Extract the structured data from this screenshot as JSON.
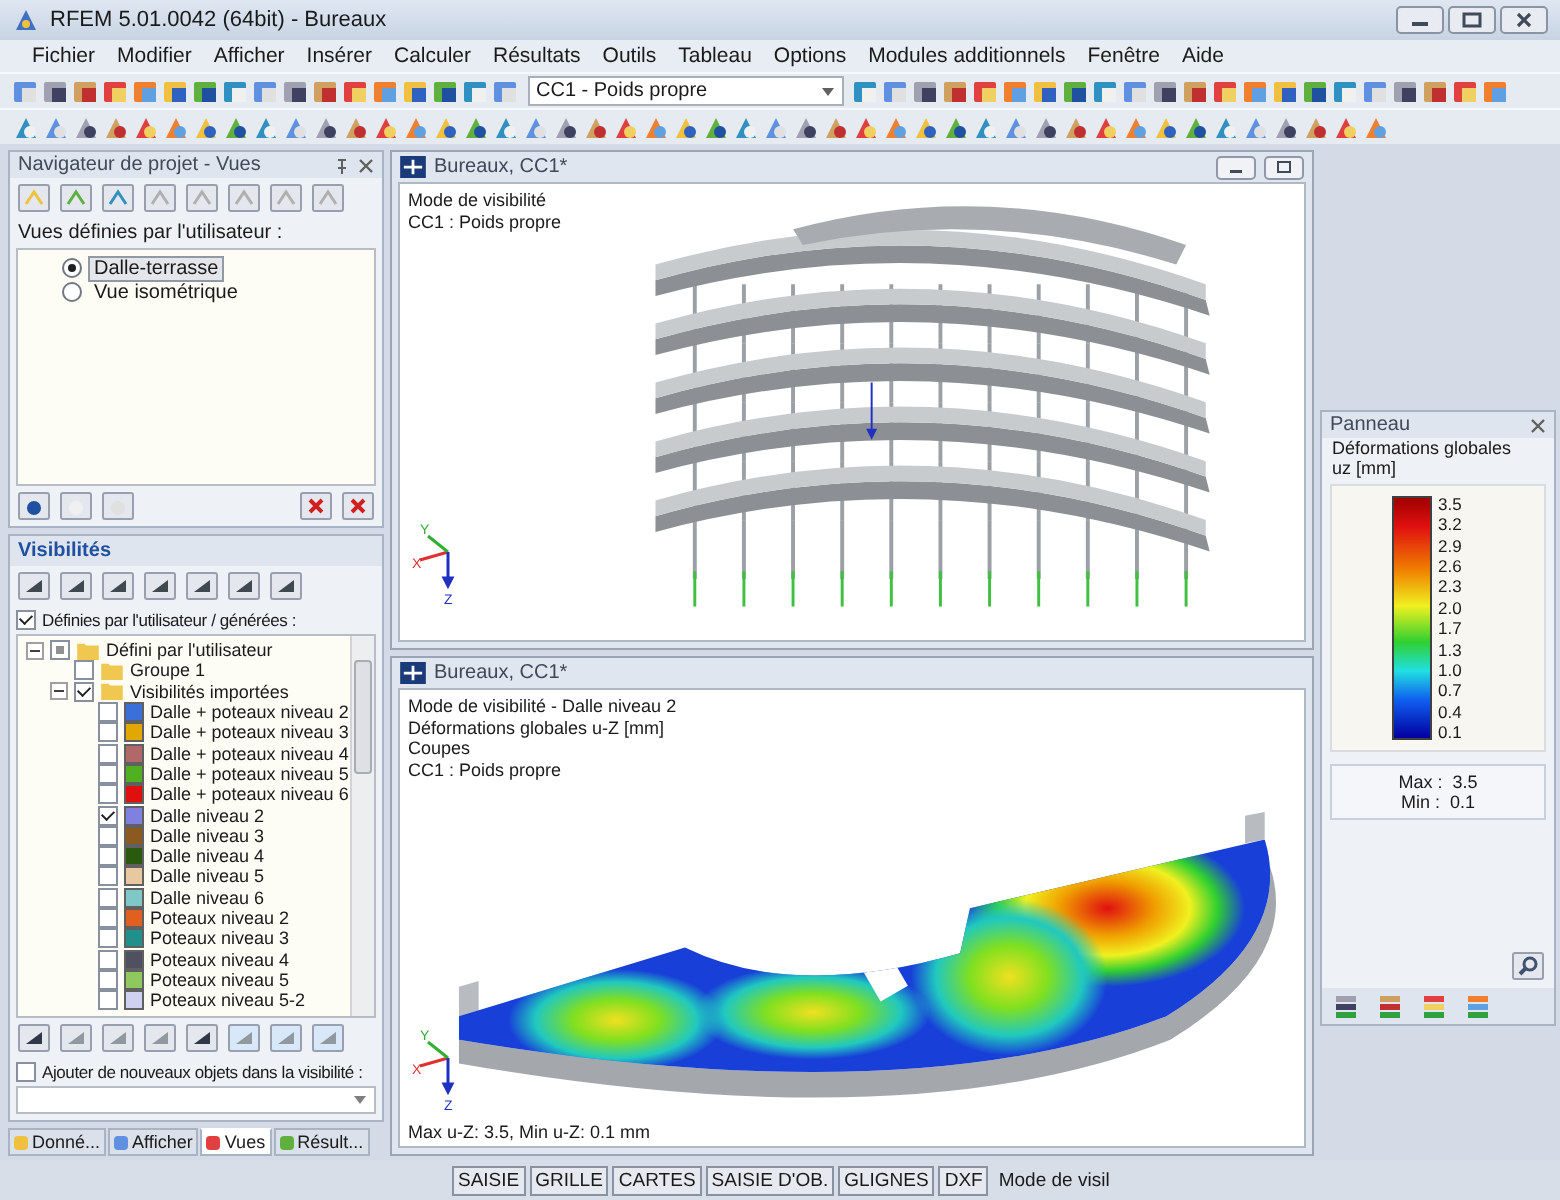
{
  "window": {
    "title": "RFEM 5.01.0042 (64bit) - Bureaux"
  },
  "menu": [
    "Fichier",
    "Modifier",
    "Afficher",
    "Insérer",
    "Calculer",
    "Résultats",
    "Outils",
    "Tableau",
    "Options",
    "Modules additionnels",
    "Fenêtre",
    "Aide"
  ],
  "toolbar": {
    "load_case": "CC1 - Poids propre"
  },
  "navigator": {
    "title": "Navigateur de projet - Vues",
    "views_label": "Vues définies par l'utilisateur :",
    "views": [
      {
        "label": "Dalle-terrasse",
        "selected": true
      },
      {
        "label": "Vue isométrique",
        "selected": false
      }
    ]
  },
  "visibilities": {
    "title": "Visibilités",
    "filter": {
      "label": "Définies par l'utilisateur / générées :",
      "checked": true
    },
    "tree": [
      {
        "label": "Défini par l'utilisateur",
        "indeterminate": true,
        "expanded": true,
        "children": [
          {
            "label": "Groupe 1",
            "checked": false
          },
          {
            "label": "Visibilités importées",
            "checked": true,
            "expanded": true,
            "children": [
              {
                "label": "Dalle + poteaux niveau 2",
                "checked": false,
                "color": "#3a70d8"
              },
              {
                "label": "Dalle + poteaux niveau 3",
                "checked": false,
                "color": "#e0a800"
              },
              {
                "label": "Dalle + poteaux niveau 4",
                "checked": false,
                "color": "#b06868"
              },
              {
                "label": "Dalle + poteaux niveau 5",
                "checked": false,
                "color": "#50b020"
              },
              {
                "label": "Dalle + poteaux niveau 6",
                "checked": false,
                "color": "#e01010"
              },
              {
                "label": "Dalle niveau 2",
                "checked": true,
                "color": "#8080e0"
              },
              {
                "label": "Dalle niveau 3",
                "checked": false,
                "color": "#8a5a20"
              },
              {
                "label": "Dalle niveau 4",
                "checked": false,
                "color": "#2a5a10"
              },
              {
                "label": "Dalle niveau 5",
                "checked": false,
                "color": "#e8c8a0"
              },
              {
                "label": "Dalle niveau 6",
                "checked": false,
                "color": "#80c8c8"
              },
              {
                "label": "Poteaux niveau 2",
                "checked": false,
                "color": "#e06020"
              },
              {
                "label": "Poteaux niveau 3",
                "checked": false,
                "color": "#20908a"
              },
              {
                "label": "Poteaux niveau 4",
                "checked": false,
                "color": "#505060"
              },
              {
                "label": "Poteaux niveau 5",
                "checked": false,
                "color": "#90c860"
              },
              {
                "label": "Poteaux niveau 5-2",
                "checked": false,
                "color": "#d0d0f0"
              }
            ]
          }
        ]
      }
    ],
    "add_objects": {
      "label": "Ajouter de nouveaux objets dans la visibilité :",
      "checked": false
    },
    "tabs": [
      {
        "label": "Donné...",
        "selected": false
      },
      {
        "label": "Afficher",
        "selected": false
      },
      {
        "label": "Vues",
        "selected": true
      },
      {
        "label": "Résult...",
        "selected": false
      }
    ]
  },
  "views": [
    {
      "title": "Bureaux, CC1*",
      "kind": "building",
      "info": [
        "Mode de visibilité",
        "CC1 : Poids propre"
      ],
      "axes": [
        "X",
        "Y",
        "Z"
      ]
    },
    {
      "title": "Bureaux, CC1*",
      "kind": "contour",
      "info": [
        "Mode de visibilité - Dalle niveau 2",
        "Déformations globales u-Z [mm]",
        "Coupes",
        "CC1 : Poids propre"
      ],
      "axes": [
        "X",
        "Y",
        "Z"
      ],
      "footer": "Max u-Z: 3.5, Min u-Z: 0.1 mm"
    }
  ],
  "panel": {
    "title": "Panneau",
    "heading": "Déformations globales",
    "unit": "uz [mm]",
    "legend": [
      "3.5",
      "3.2",
      "2.9",
      "2.6",
      "2.3",
      "2.0",
      "1.7",
      "1.3",
      "1.0",
      "0.7",
      "0.4",
      "0.1"
    ],
    "max_label": "Max :",
    "max": "3.5",
    "min_label": "Min :",
    "min": "0.1"
  },
  "status_bar": {
    "tabs": [
      "SAISIE",
      "GRILLE",
      "CARTES",
      "SAISIE D'OB.",
      "GLIGNES",
      "DXF"
    ],
    "text": "Mode de visil"
  }
}
